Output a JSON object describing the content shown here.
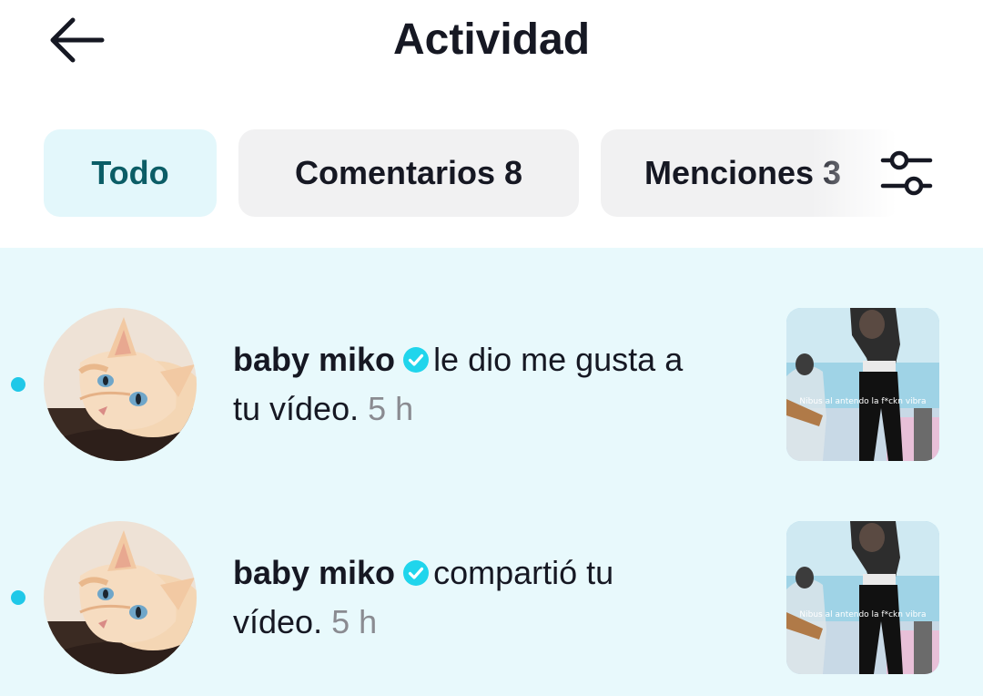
{
  "header": {
    "title": "Actividad",
    "back_icon": "arrow-left-icon"
  },
  "tabs": [
    {
      "label": "Todo",
      "active": true
    },
    {
      "label": "Comentarios 8",
      "active": false
    },
    {
      "label": "Menciones 3",
      "active": false
    }
  ],
  "filter_icon": "sliders-icon",
  "colors": {
    "accent": "#20c8e8",
    "active_tab_bg": "#e3f7fb",
    "active_tab_text": "#0b5d66",
    "list_bg": "#e8f9fc",
    "verified": "#20d5ec"
  },
  "notifications": [
    {
      "username": "baby miko",
      "verified": true,
      "action_line1": "le dio me gusta a",
      "action_line2": "tu vídeo.",
      "time": "5 h",
      "unread": true,
      "thumbnail_caption": "Nibus al antendo la f*ckn vibra"
    },
    {
      "username": "baby miko",
      "verified": true,
      "action_line1": "compartió tu",
      "action_line2": "vídeo.",
      "time": "5 h",
      "unread": true,
      "thumbnail_caption": "Nibus al antendo la f*ckn vibra"
    }
  ]
}
